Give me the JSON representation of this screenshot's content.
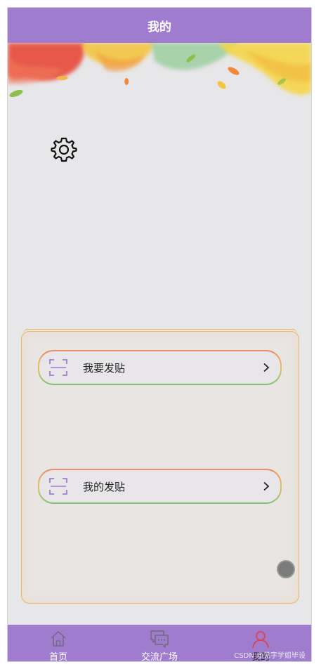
{
  "header": {
    "title": "我的"
  },
  "menu": {
    "items": [
      {
        "label": "我要发贴"
      },
      {
        "label": "我的发贴"
      }
    ]
  },
  "tabbar": {
    "tabs": [
      {
        "label": "首页"
      },
      {
        "label": "交流广场"
      },
      {
        "label": "我的"
      }
    ]
  },
  "watermark": "CSDN @见字学姐毕设",
  "colors": {
    "accent": "#a07ccf",
    "background": "#e7e6e8",
    "active_tab_icon": "#d44a5a"
  }
}
